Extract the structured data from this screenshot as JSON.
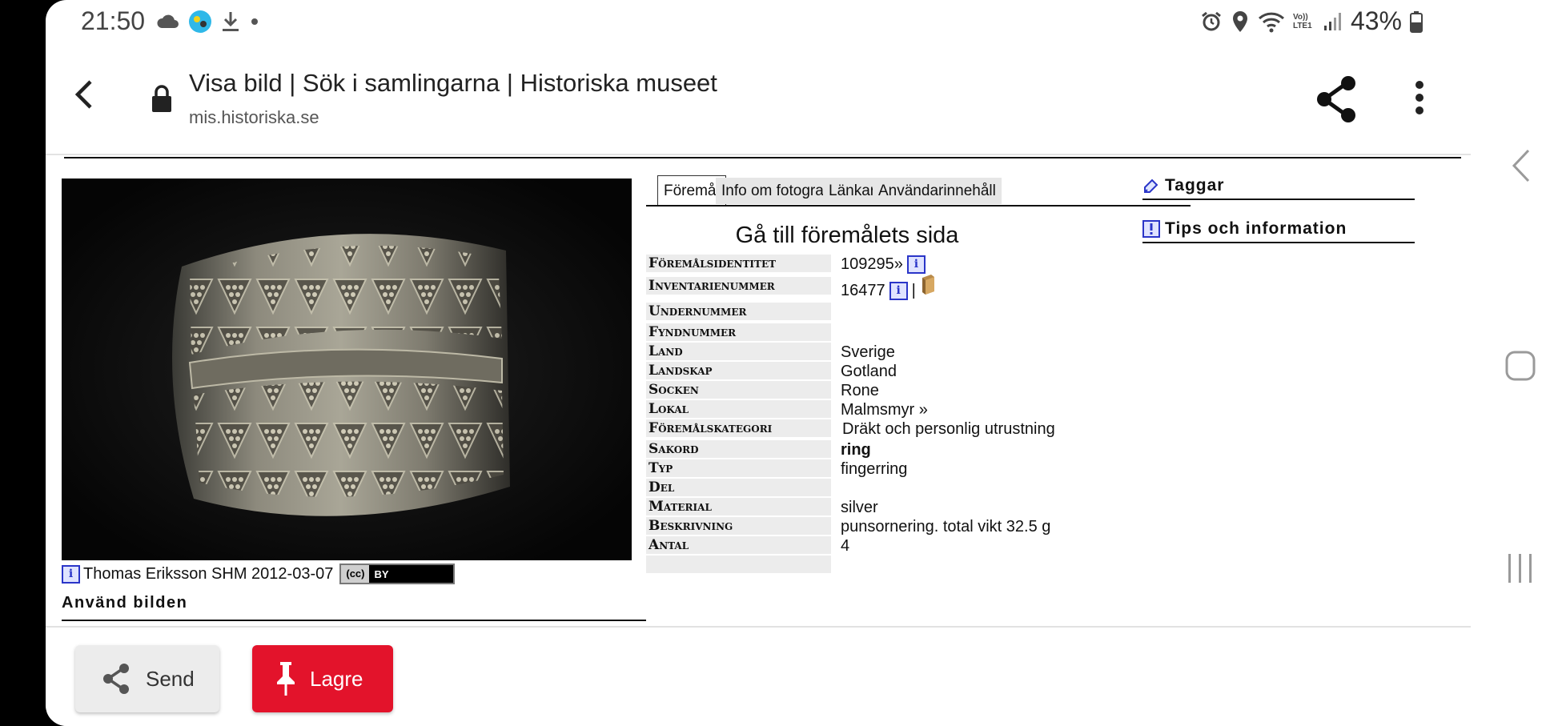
{
  "status_bar": {
    "time": "21:50",
    "battery": "43%",
    "network_label": "Vo)) LTE1"
  },
  "browser": {
    "page_title": "Visa bild | Sök i samlingarna | Historiska museet",
    "url": "mis.historiska.se"
  },
  "image_panel": {
    "caption": "Thomas Eriksson SHM 2012-03-07",
    "license": {
      "cc": "(cc)",
      "by": "BY"
    },
    "use_image_label": "Använd bilden"
  },
  "tabs": [
    {
      "label": "Föremål",
      "active": true
    },
    {
      "label": "Info om fotografi",
      "active": false
    },
    {
      "label": "Länkar",
      "active": false
    },
    {
      "label": "Användarinnehåll",
      "active": false
    }
  ],
  "goto_label": "Gå till föremålets sida",
  "fields": [
    {
      "label": "Föremålsidentitet",
      "value": "109295»"
    },
    {
      "label": "Inventarienummer",
      "value": "16477",
      "separator": "|"
    },
    {
      "label": "Undernummer",
      "value": ""
    },
    {
      "label": "Fyndnummer",
      "value": ""
    },
    {
      "label": "Land",
      "value": "Sverige"
    },
    {
      "label": "Landskap",
      "value": "Gotland"
    },
    {
      "label": "Socken",
      "value": "Rone"
    },
    {
      "label": "Lokal",
      "value": "Malmsmyr »"
    },
    {
      "label": "Föremålskategori",
      "value": "Dräkt och personlig utrustning"
    },
    {
      "label": "Sakord",
      "value": "ring"
    },
    {
      "label": "Typ",
      "value": "fingerring"
    },
    {
      "label": "Del",
      "value": ""
    },
    {
      "label": "Material",
      "value": "silver"
    },
    {
      "label": "Beskrivning",
      "value": "punsornering. total vikt 32.5 g"
    },
    {
      "label": "Antal",
      "value": "4"
    }
  ],
  "side_links": {
    "tags": "Taggar",
    "tips": "Tips och information"
  },
  "actions": {
    "send": "Send",
    "save": "Lagre"
  },
  "colors": {
    "save_button": "#e3132b",
    "info_icon": "#2a35c8"
  }
}
